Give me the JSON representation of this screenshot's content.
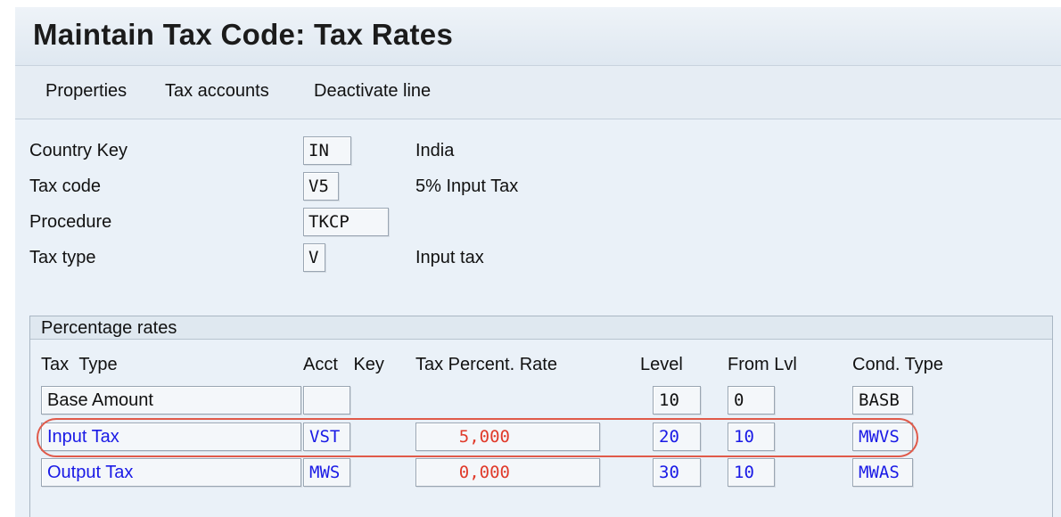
{
  "title": "Maintain Tax Code: Tax Rates",
  "toolbar": {
    "properties": "Properties",
    "tax_accounts": "Tax accounts",
    "deactivate_line": "Deactivate line"
  },
  "header": {
    "country_key": {
      "label": "Country Key",
      "value": "IN",
      "text": "India"
    },
    "tax_code": {
      "label": "Tax code",
      "value": "V5",
      "text": "5% Input Tax"
    },
    "procedure": {
      "label": "Procedure",
      "value": "TKCP"
    },
    "tax_type": {
      "label": "Tax type",
      "value": "V",
      "text": "Input tax"
    }
  },
  "rates": {
    "group_title": "Percentage rates",
    "columns": {
      "tax_type": "Tax Type",
      "acct_key": "Acct Key",
      "rate": "Tax Percent. Rate",
      "level": "Level",
      "from_lvl": "From Lvl",
      "cond_type": "Cond. Type"
    },
    "rows": [
      {
        "tax_type": "Base Amount",
        "acct_key": "",
        "rate": "",
        "level": "10",
        "from_lvl": "0",
        "cond_type": "BASB"
      },
      {
        "tax_type": "Input Tax",
        "acct_key": "VST",
        "rate": "5,000",
        "level": "20",
        "from_lvl": "10",
        "cond_type": "MWVS"
      },
      {
        "tax_type": "Output Tax",
        "acct_key": "MWS",
        "rate": "0,000",
        "level": "30",
        "from_lvl": "10",
        "cond_type": "MWAS"
      }
    ]
  },
  "colors": {
    "link_blue": "#1a1ae6",
    "rate_red": "#e03a2a",
    "highlight": "#e05a4a"
  }
}
